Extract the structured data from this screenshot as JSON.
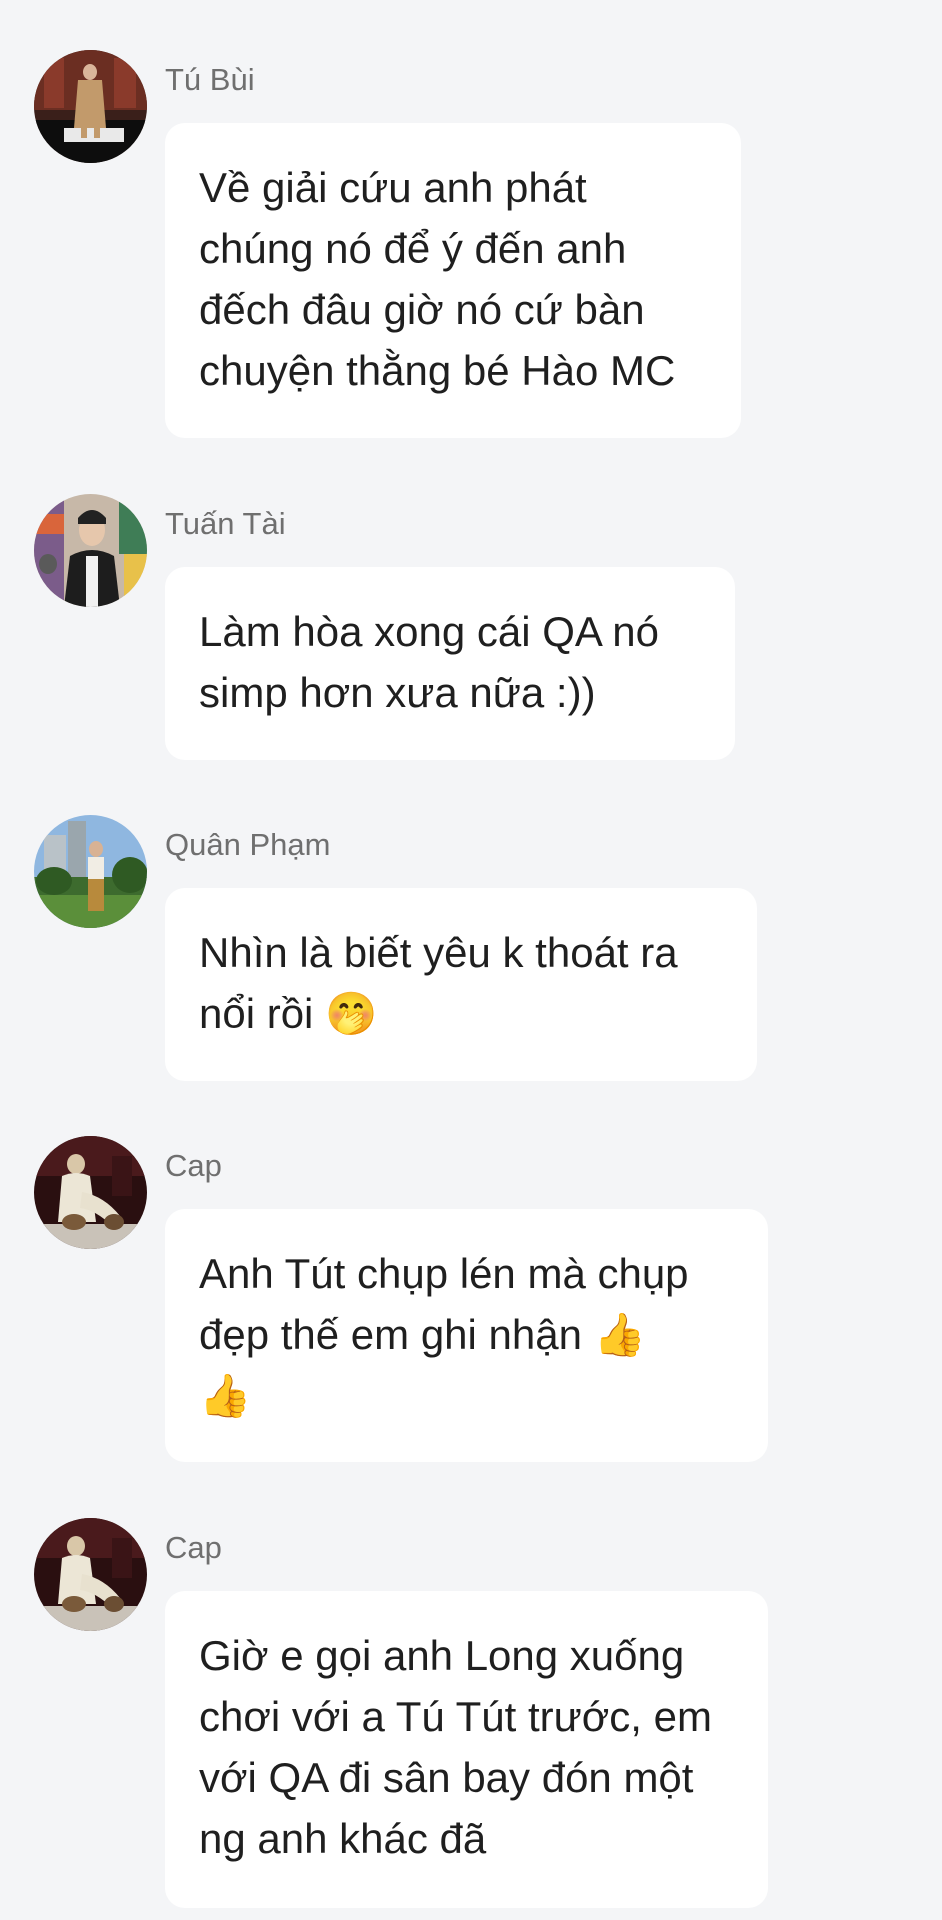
{
  "messages": [
    {
      "sender": "Tú Bùi",
      "avatar": "avatar-tu-bui",
      "text": "Về giải cứu anh phát\nchúng nó để ý đến anh\nđếch đâu giờ nó cứ bàn\nchuyện thằng bé Hào MC"
    },
    {
      "sender": "Tuấn Tài",
      "avatar": "avatar-tuan-tai",
      "text": "Làm hòa xong cái QA nó\nsimp hơn xưa nữa :))"
    },
    {
      "sender": "Quân Phạm",
      "avatar": "avatar-quan-pham",
      "text": "Nhìn là biết yêu k thoát ra\nnổi rồi 🤭"
    },
    {
      "sender": "Cap",
      "avatar": "avatar-cap",
      "text": "Anh Tút chụp lén mà chụp\nđẹp thế em ghi nhận 👍\n👍"
    },
    {
      "sender": "Cap",
      "avatar": "avatar-cap",
      "text": "Giờ e gọi anh Long xuống\nchơi với a Tú Tút trước, em\nvới QA đi sân bay đón một\nng anh khác đã"
    }
  ],
  "colors": {
    "background": "#f4f5f7",
    "bubble": "#ffffff",
    "sender_text": "#6f6f6f",
    "message_text": "#1f1f1f"
  }
}
